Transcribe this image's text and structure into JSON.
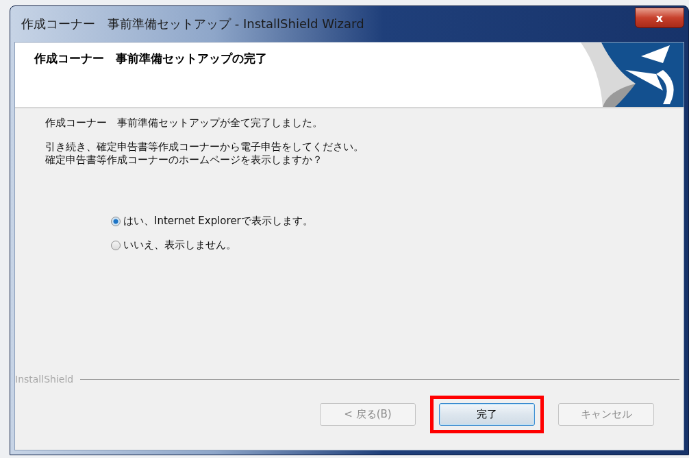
{
  "window": {
    "title": "作成コーナー　事前準備セットアップ - InstallShield Wizard",
    "close": "x"
  },
  "header": {
    "title": "作成コーナー　事前準備セットアップの完了"
  },
  "body": {
    "paragraphs": [
      {
        "lines": [
          "作成コーナー　事前準備セットアップが全て完了しました。"
        ]
      },
      {
        "lines": [
          "引き続き、確定申告書等作成コーナーから電子申告をしてください。",
          "確定申告書等作成コーナーのホームページを表示しますか？"
        ]
      }
    ],
    "options": [
      {
        "label": "はい、Internet Explorerで表示します。",
        "selected": true
      },
      {
        "label": "いいえ、表示しません。",
        "selected": false
      }
    ]
  },
  "footer": {
    "brand": "InstallShield"
  },
  "buttons": [
    {
      "label": "< 戻る(B)",
      "disabled": true,
      "default": false,
      "highlighted": false
    },
    {
      "label": "完了",
      "disabled": false,
      "default": true,
      "highlighted": true
    },
    {
      "label": "キャンセル",
      "disabled": true,
      "default": false,
      "highlighted": false
    }
  ]
}
